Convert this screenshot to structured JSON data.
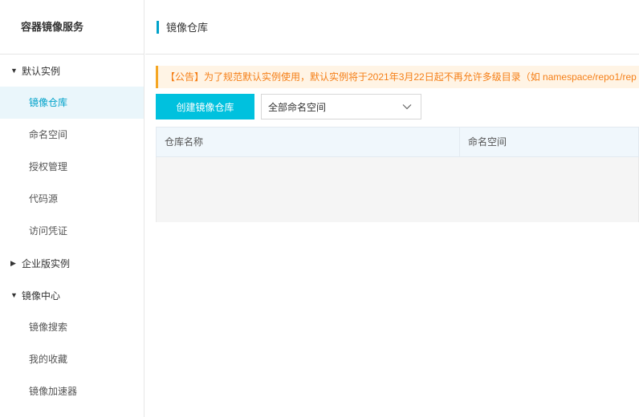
{
  "sidebar": {
    "title": "容器镜像服务",
    "groups": [
      {
        "label": "默认实例",
        "expanded": true,
        "items": [
          {
            "label": "镜像仓库",
            "active": true
          },
          {
            "label": "命名空间"
          },
          {
            "label": "授权管理"
          },
          {
            "label": "代码源"
          },
          {
            "label": "访问凭证"
          }
        ]
      },
      {
        "label": "企业版实例",
        "expanded": false,
        "items": []
      },
      {
        "label": "镜像中心",
        "expanded": true,
        "items": [
          {
            "label": "镜像搜索"
          },
          {
            "label": "我的收藏"
          },
          {
            "label": "镜像加速器"
          }
        ]
      }
    ]
  },
  "header": {
    "title": "镜像仓库"
  },
  "notice": {
    "text": "【公告】为了规范默认实例使用，默认实例将于2021年3月22日起不再允许多级目录（如 namespace/repo1/rep"
  },
  "toolbar": {
    "create_label": "创建镜像仓库",
    "namespace_select": "全部命名空间"
  },
  "table": {
    "columns": [
      "仓库名称",
      "命名空间"
    ]
  },
  "colors": {
    "accent": "#00c1de",
    "active_text": "#00a2ca",
    "notice_bg": "#fff4e5",
    "notice_text": "#f57f17"
  }
}
